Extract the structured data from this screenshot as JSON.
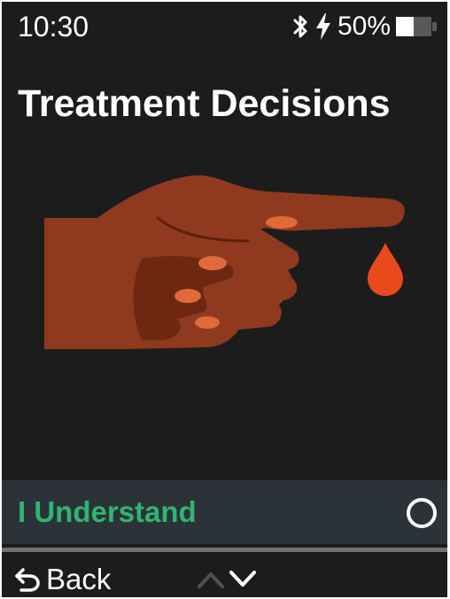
{
  "status_bar": {
    "time": "10:30",
    "battery_percent": "50%",
    "battery_level": 0.5,
    "icons": [
      "bluetooth-icon",
      "charging-icon",
      "battery-icon"
    ]
  },
  "screen": {
    "title": "Treatment Decisions",
    "illustration": "hand-finger-blood-drop"
  },
  "acknowledge": {
    "label": "I Understand",
    "selected": false
  },
  "footer": {
    "back_label": "Back",
    "nav_icons": [
      "chevron-up-icon",
      "chevron-down-icon"
    ]
  },
  "colors": {
    "background": "#1c1c1c",
    "text": "#ffffff",
    "accent_green": "#2fb56f",
    "row_highlight": "#2b3238",
    "blood_drop": "#e84a1c",
    "skin": "#8f3a1f",
    "skin_shadow": "#6e2812",
    "nail": "#e06a3a",
    "disabled": "#4a5158"
  }
}
